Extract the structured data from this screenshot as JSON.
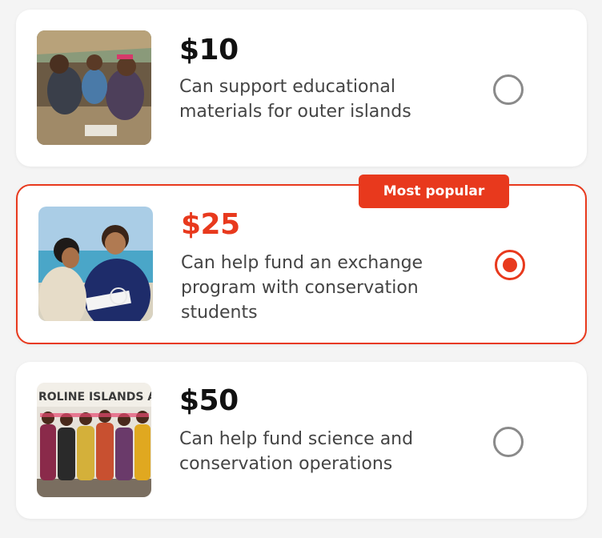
{
  "options": [
    {
      "amount": "$10",
      "description": "Can support educational materials for outer islands",
      "selected": false,
      "image": "photo-group-studying"
    },
    {
      "amount": "$25",
      "description": "Can help fund an exchange program with conservation students",
      "selected": true,
      "image": "photo-students-ocean"
    },
    {
      "amount": "$50",
      "description": "Can help fund science and conservation operations",
      "selected": false,
      "image": "photo-caroline-islands-group"
    }
  ],
  "badge": {
    "label": "Most popular"
  },
  "photo_sign_text": "ROLINE ISLANDS AIR",
  "colors": {
    "accent": "#e8391d",
    "radio_off": "#8a8a8a",
    "text": "#444444",
    "amount": "#111111"
  }
}
